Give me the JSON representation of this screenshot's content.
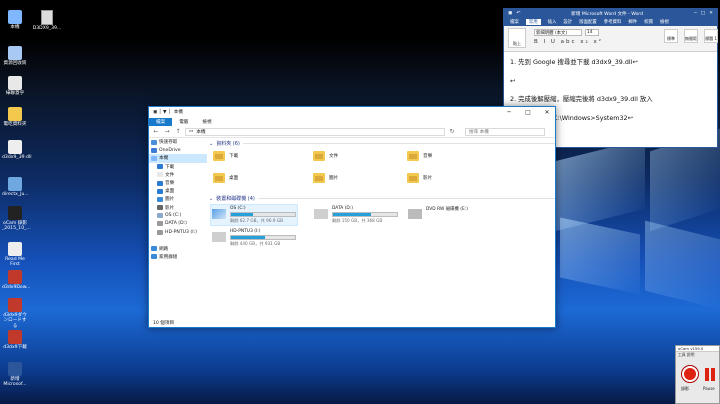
{
  "desktop": {
    "icons": [
      {
        "label": "本機",
        "color": "#7fb8ff"
      },
      {
        "label": "資源回收筒",
        "color": "#a9c9f5"
      },
      {
        "label": "綠聯蓋乎",
        "color": "#e8e8e8"
      },
      {
        "label": "電吃資料夾",
        "color": "#f2c94c"
      },
      {
        "label": "d3dx9_39.dll",
        "color": "#eeeeee"
      },
      {
        "label": "directx_Ju...",
        "color": "#6fa8e0"
      },
      {
        "label": "oCam 錄影 _2015_10_...",
        "color": "#222222"
      },
      {
        "label": "Read Me First",
        "color": "#eeeeee"
      },
      {
        "label": "d3dx9Dow...",
        "color": "#c0392b"
      },
      {
        "label": "d3dx9ダウンロードする",
        "color": "#c0392b"
      },
      {
        "label": "d3dx9下載",
        "color": "#c0392b"
      },
      {
        "label": "新增 Microsof...",
        "color": "#2b579a"
      }
    ],
    "second_icon": {
      "label": "D3DX9_39..."
    }
  },
  "word": {
    "title": "新增 Microsoft Word 文件 - Word",
    "tabs": [
      "檔案",
      "常用",
      "插入",
      "設計",
      "版面配置",
      "參考資料",
      "郵件",
      "校閱",
      "檢視"
    ],
    "font_name": "新細明體 (本文)",
    "font_size": "14",
    "paste_label": "貼上",
    "format_row": "B I U abc x₂ x²",
    "styles": [
      "標準",
      "無間距",
      "標題 1"
    ],
    "style_edit": "編輯",
    "line1": "1.   先到 Google 搜尋並下載 d3dx9_39.dll↩",
    "line2": "↩",
    "line3": "2.   完成後解壓縮，壓縮完後將 d3dx9_39.dll 放入",
    "line4": "C:\\Windows>System32↩"
  },
  "explorer": {
    "title": "本機",
    "title_prefix": "▣ │ ▼ │",
    "tabs": [
      "檔案",
      "電腦",
      "檢視"
    ],
    "address_path": "本機",
    "search_placeholder": "搜尋 本機",
    "side_items": [
      {
        "label": "快速存取",
        "color": "#4a90d9"
      },
      {
        "label": "OneDrive",
        "color": "#3a7bd5"
      },
      {
        "label": "本機",
        "color": "#7fb8ff",
        "selected": true
      },
      {
        "label": "下載",
        "color": "#2b7bd2"
      },
      {
        "label": "文件",
        "color": "#e8e8e8"
      },
      {
        "label": "音樂",
        "color": "#2b7bd2"
      },
      {
        "label": "桌面",
        "color": "#2b7bd2"
      },
      {
        "label": "圖片",
        "color": "#3b8ad8"
      },
      {
        "label": "影片",
        "color": "#666666"
      },
      {
        "label": "OS (C:)",
        "color": "#8aa8c8"
      },
      {
        "label": "DATA (D:)",
        "color": "#999999"
      },
      {
        "label": "HD-PNTU3 (I:)",
        "color": "#999999"
      },
      {
        "label": "",
        "color": "#ffffff"
      },
      {
        "label": "網路",
        "color": "#3b8ad8"
      },
      {
        "label": "家用群組",
        "color": "#3b8ad8"
      }
    ],
    "folders_header": "資料夾 (6)",
    "folders": [
      "下載",
      "文件",
      "音樂",
      "桌面",
      "圖片",
      "影片"
    ],
    "drives_header": "裝置和磁碟機 (4)",
    "drives": [
      {
        "label": "OS (C:)",
        "free": "剩餘 62.7 GB，共 96.9 GB",
        "fill_pct": 35
      },
      {
        "label": "DATA (D:)",
        "free": "剩餘 150 GB，共 368 GB",
        "fill_pct": 60
      },
      {
        "label": "DVD RW 磁碟機 (E:)",
        "free": "",
        "fill_pct": 0
      },
      {
        "label": "HD-PNTU3 (I:)",
        "free": "剩餘 440 GB，共 931 GB",
        "fill_pct": 53
      }
    ],
    "status": "10 個項目"
  },
  "ocam": {
    "title": "oCam v159.0",
    "menu": "工具  說明",
    "record_label": "錄影",
    "pause_label": "Pause"
  }
}
